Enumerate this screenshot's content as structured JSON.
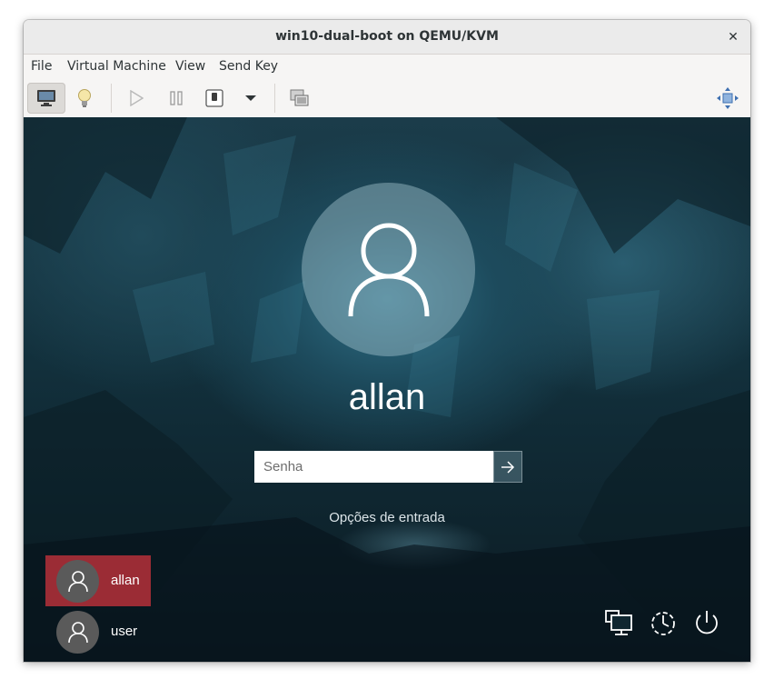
{
  "window": {
    "title": "win10-dual-boot on QEMU/KVM",
    "close_glyph": "✕"
  },
  "menu": {
    "items": [
      "File",
      "Virtual Machine",
      "View",
      "Send Key"
    ]
  },
  "toolbar": {
    "buttons": [
      "console-icon",
      "lightbulb-icon",
      "play-icon",
      "pause-icon",
      "shutdown-icon",
      "dropdown-arrow-icon",
      "snapshots-icon",
      "fullscreen-icon"
    ]
  },
  "login": {
    "username": "allan",
    "password_placeholder": "Senha",
    "signin_options": "Opções de entrada",
    "users": [
      {
        "name": "allan",
        "selected": true
      },
      {
        "name": "user",
        "selected": false
      }
    ],
    "system_icons": [
      "network-icon",
      "accessibility-icon",
      "power-icon"
    ]
  },
  "colors": {
    "selected_user": "#9b2c35",
    "titlebar": "#ebebeb"
  }
}
